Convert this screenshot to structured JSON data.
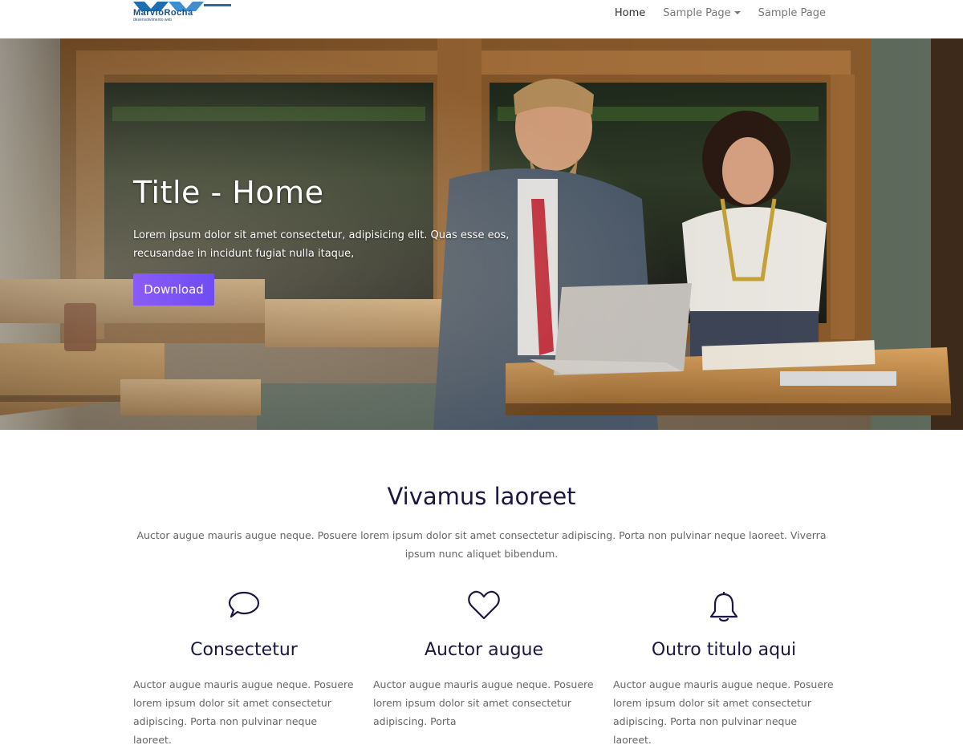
{
  "brand": {
    "name": "MarvioRocha",
    "tagline": "desenvolvimento web"
  },
  "nav": {
    "items": [
      {
        "label": "Home",
        "active": true
      },
      {
        "label": "Sample Page",
        "has_dropdown": true
      },
      {
        "label": "Sample Page",
        "has_dropdown": false
      }
    ]
  },
  "hero": {
    "title": "Title - Home",
    "text": "Lorem ipsum dolor sit amet consectetur, adipisicing elit. Quas esse eos, recusandae in incidunt fugiat nulla itaque,",
    "button_label": "Download"
  },
  "section": {
    "title": "Vivamus laoreet",
    "description": "Auctor augue mauris augue neque. Posuere lorem ipsum dolor sit amet consectetur adipiscing. Porta non pulvinar neque laoreet. Viverra ipsum nunc aliquet bibendum."
  },
  "features": [
    {
      "icon": "chat-bubble-icon",
      "title": "Consectetur",
      "text": "Auctor augue mauris augue neque. Posuere lorem ipsum dolor sit amet consectetur adipiscing. Porta non pulvinar neque laoreet."
    },
    {
      "icon": "heart-icon",
      "title": "Auctor augue",
      "text": "Auctor augue mauris augue neque. Posuere lorem ipsum dolor sit amet consectetur adipiscing. Porta"
    },
    {
      "icon": "bell-icon",
      "title": "Outro titulo aqui",
      "text": "Auctor augue mauris augue neque. Posuere lorem ipsum dolor sit amet consectetur adipiscing. Porta non pulvinar neque laoreet."
    }
  ],
  "colors": {
    "accent": "#7b55f6",
    "heading": "#1b1744",
    "text": "#666666"
  }
}
